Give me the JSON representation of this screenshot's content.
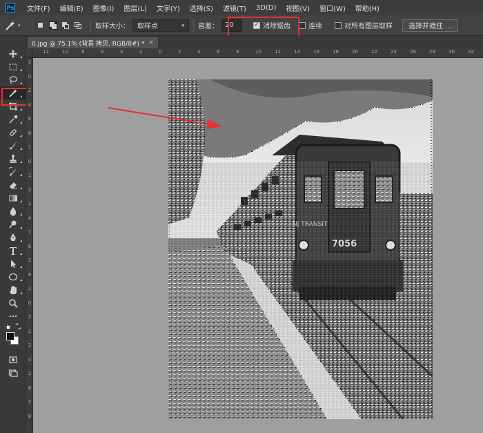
{
  "app": {
    "logo": "Ps"
  },
  "menu": [
    "文件(F)",
    "编辑(E)",
    "图像(I)",
    "图层(L)",
    "文字(Y)",
    "选择(S)",
    "滤镜(T)",
    "3D(D)",
    "视图(V)",
    "窗口(W)",
    "帮助(H)"
  ],
  "options": {
    "tool_icon": "magic-wand-icon",
    "sample_size_label": "取样大小：",
    "sample_size_value": "取样点",
    "tolerance_label": "容差：",
    "tolerance_value": "20",
    "antialias_label": "消除锯齿",
    "antialias_checked": true,
    "contiguous_label": "连续",
    "contiguous_checked": false,
    "sample_all_layers_label": "对所有图层取样",
    "sample_all_layers_checked": false,
    "select_and_mask_label": "选择并遮住 ..."
  },
  "document": {
    "tab_title": "0.jpg @ 75.1% (背景 拷贝, RGB/8#) *",
    "tab_close": "×"
  },
  "ruler": {
    "top_numbers": [
      "12",
      "10",
      "8",
      "6",
      "4",
      "2",
      "0",
      "2",
      "4",
      "6",
      "8",
      "10",
      "12",
      "14",
      "16",
      "18",
      "20",
      "22",
      "24",
      "26",
      "28",
      "30",
      "32"
    ],
    "left_numbers": [
      "2",
      "0",
      "2",
      "4",
      "6",
      "8",
      "1",
      "0",
      "1",
      "2",
      "1",
      "4",
      "1",
      "6",
      "1",
      "8",
      "2",
      "0",
      "2",
      "2",
      "2",
      "4",
      "2",
      "6",
      "2",
      "8"
    ]
  },
  "image": {
    "train_number": "7056",
    "train_brand": "NJ TRANSIT"
  },
  "annotations": {
    "highlight_color": "#e33232"
  },
  "toolbar": {
    "tools": [
      "move-icon",
      "marquee-icon",
      "lasso-icon",
      "magic-wand-icon",
      "crop-icon",
      "eyedropper-icon",
      "healing-brush-icon",
      "brush-icon",
      "clone-stamp-icon",
      "history-brush-icon",
      "eraser-icon",
      "gradient-icon",
      "blur-icon",
      "dodge-icon",
      "pen-icon",
      "type-icon",
      "path-selection-icon",
      "ellipse-icon",
      "hand-icon",
      "zoom-icon",
      "more-tools-icon"
    ],
    "selected": "magic-wand-icon"
  }
}
